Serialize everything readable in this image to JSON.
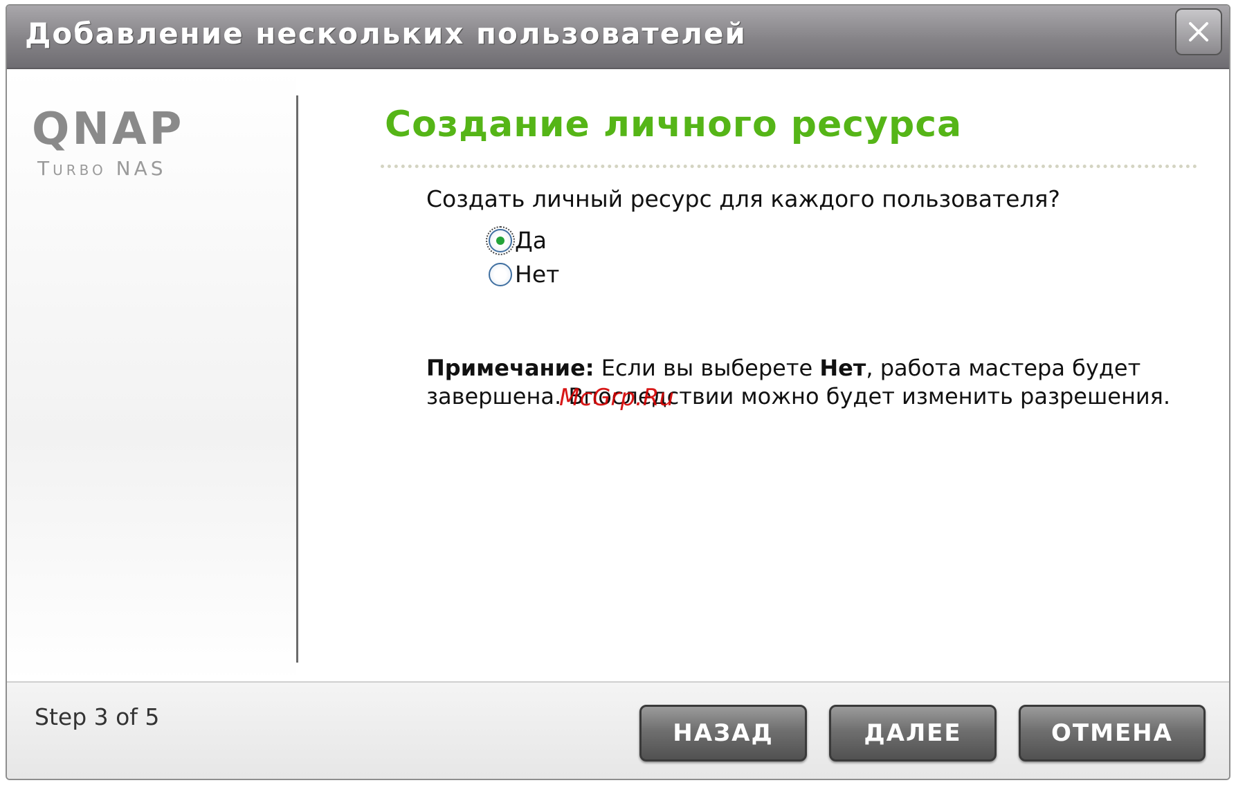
{
  "window": {
    "title": "Добавление нескольких пользователей",
    "close_label": "X"
  },
  "sidebar": {
    "logo_main": "QNAP",
    "logo_sub": "Turbo NAS"
  },
  "main": {
    "heading": "Создание личного ресурса",
    "question": "Создать личный ресурс для каждого пользователя?",
    "options": [
      {
        "label": "Да",
        "selected": true
      },
      {
        "label": "Нет",
        "selected": false
      }
    ],
    "note": {
      "label": "Примечание:",
      "text_before": " Если вы выберете ",
      "emphasis": "Нет",
      "text_after": ", работа мастера будет завершена. Впоследствии можно будет изменить разрешения."
    },
    "watermark": "McGrp.Ru"
  },
  "footer": {
    "step": "Step 3 of 5",
    "buttons": {
      "back": "НАЗАД",
      "next": "ДАЛЕЕ",
      "cancel": "ОТМЕНА"
    }
  },
  "colors": {
    "heading": "#55b517",
    "titlebar": "#858387",
    "button": "#6f6f6f"
  }
}
